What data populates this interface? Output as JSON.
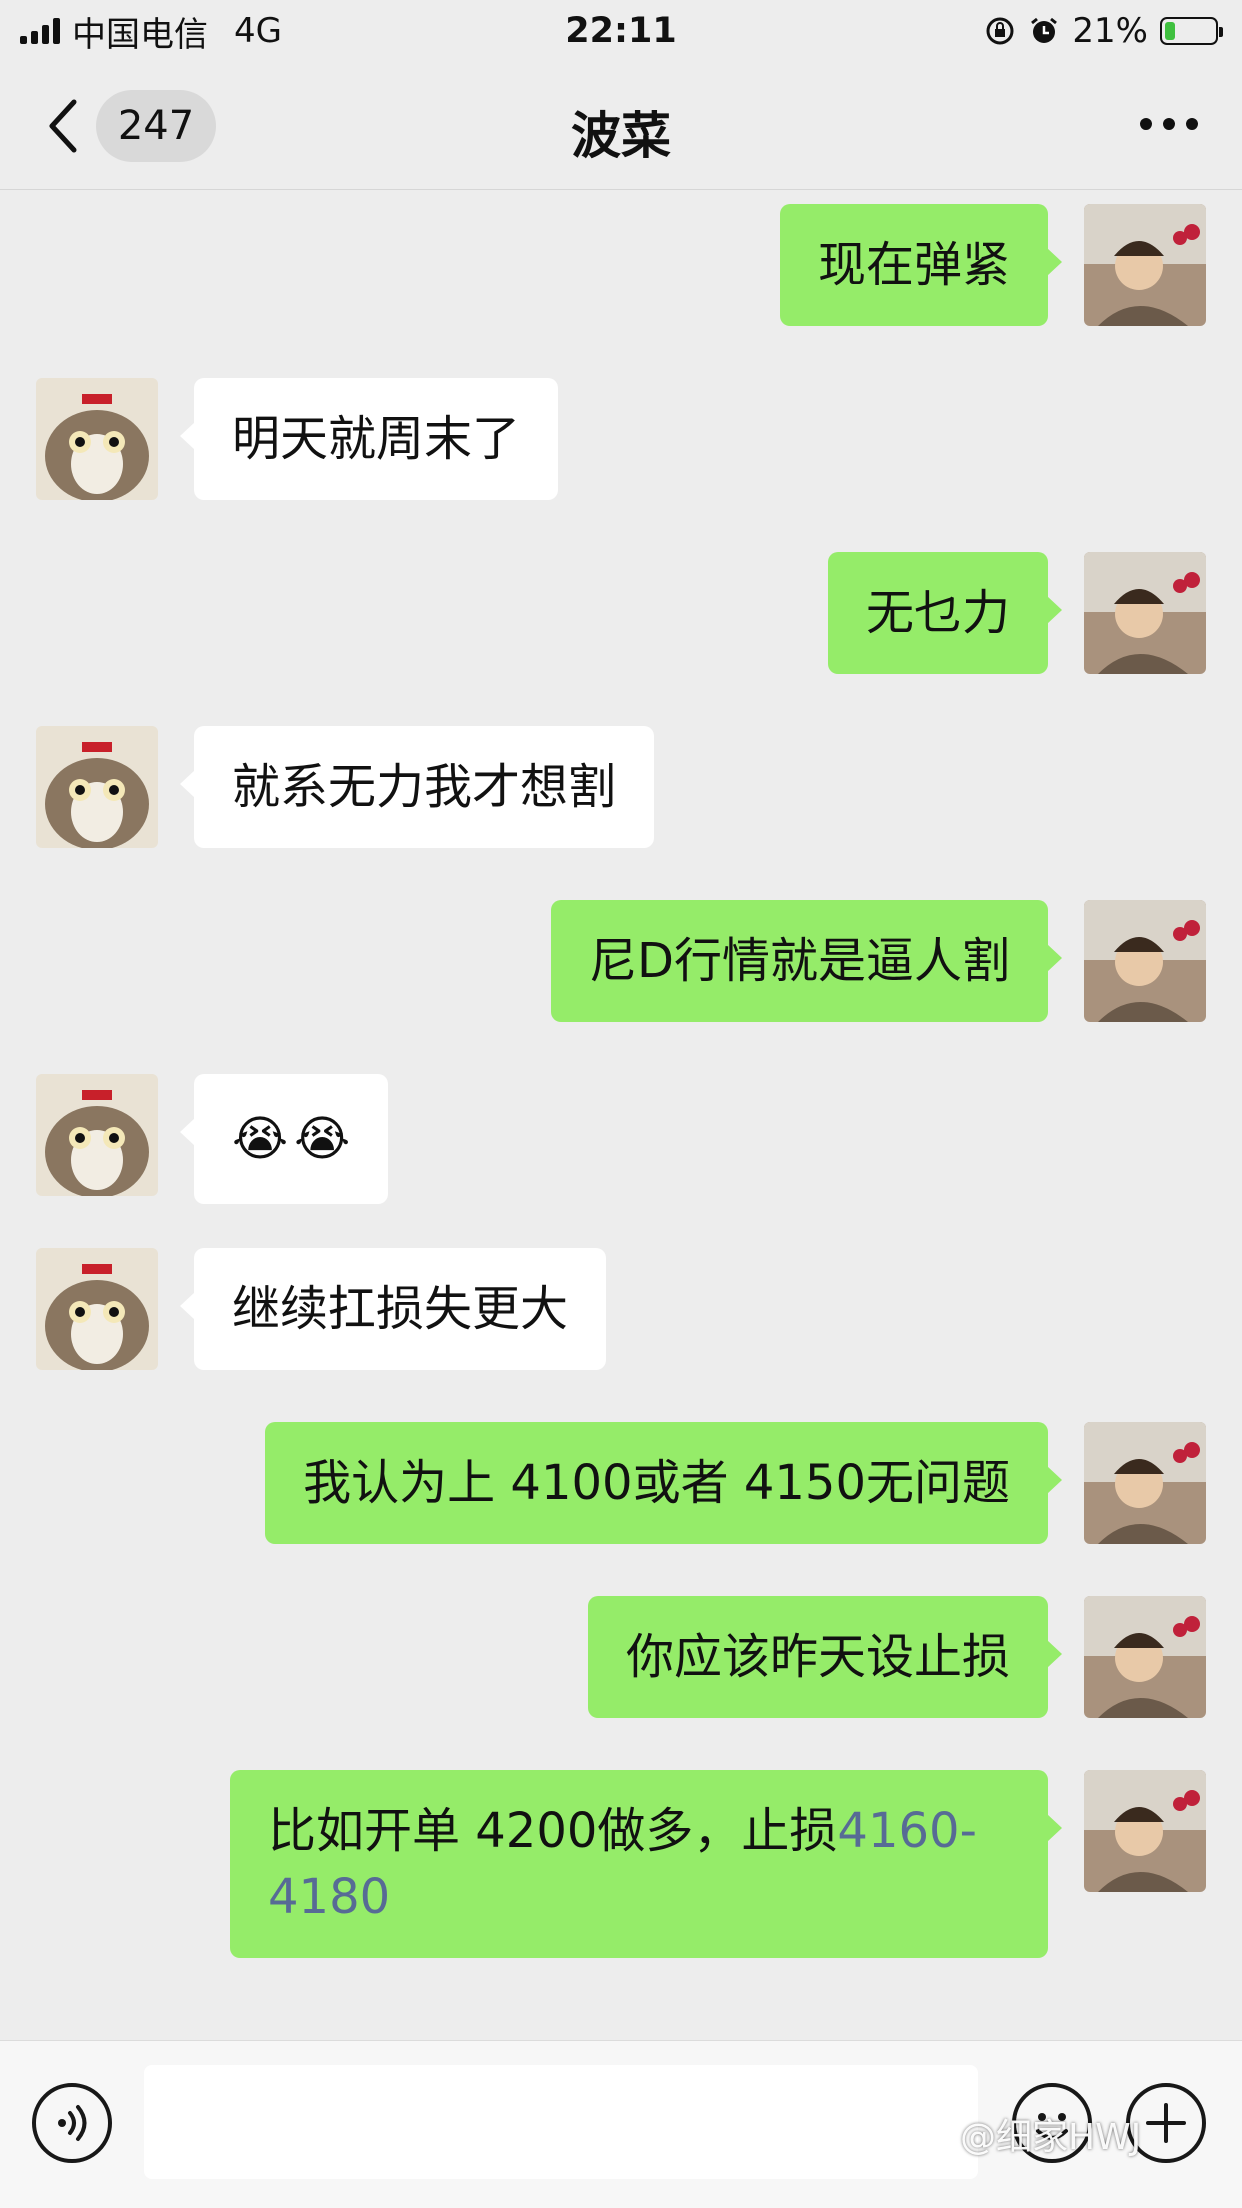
{
  "status_bar": {
    "carrier": "中国电信",
    "network": "4G",
    "time": "22:11",
    "battery": "21%",
    "battery_level": 0.21
  },
  "nav": {
    "unread_count": "247",
    "title": "波菜"
  },
  "messages": [
    {
      "side": "right",
      "text": "现在弹紧"
    },
    {
      "side": "left",
      "text": "明天就周末了"
    },
    {
      "side": "right",
      "text": "无乜力"
    },
    {
      "side": "left",
      "text": "就系无力我才想割"
    },
    {
      "side": "right",
      "text": "尼D行情就是逼人割"
    },
    {
      "side": "left",
      "emoji": [
        "😭",
        "😭"
      ]
    },
    {
      "side": "left",
      "text": "继续扛损失更大"
    },
    {
      "side": "right",
      "text": "我认为上 4100或者 4150无问题"
    },
    {
      "side": "right",
      "text": "你应该昨天设止损"
    },
    {
      "side": "right",
      "text_prefix": "比如开单 4200做多，止损",
      "link_text": "4160-4180"
    }
  ],
  "watermark": "@细家HWJ",
  "colors": {
    "self_bubble": "#95ec69",
    "other_bubble": "#ffffff",
    "background": "#ededed",
    "link": "#576b95"
  }
}
